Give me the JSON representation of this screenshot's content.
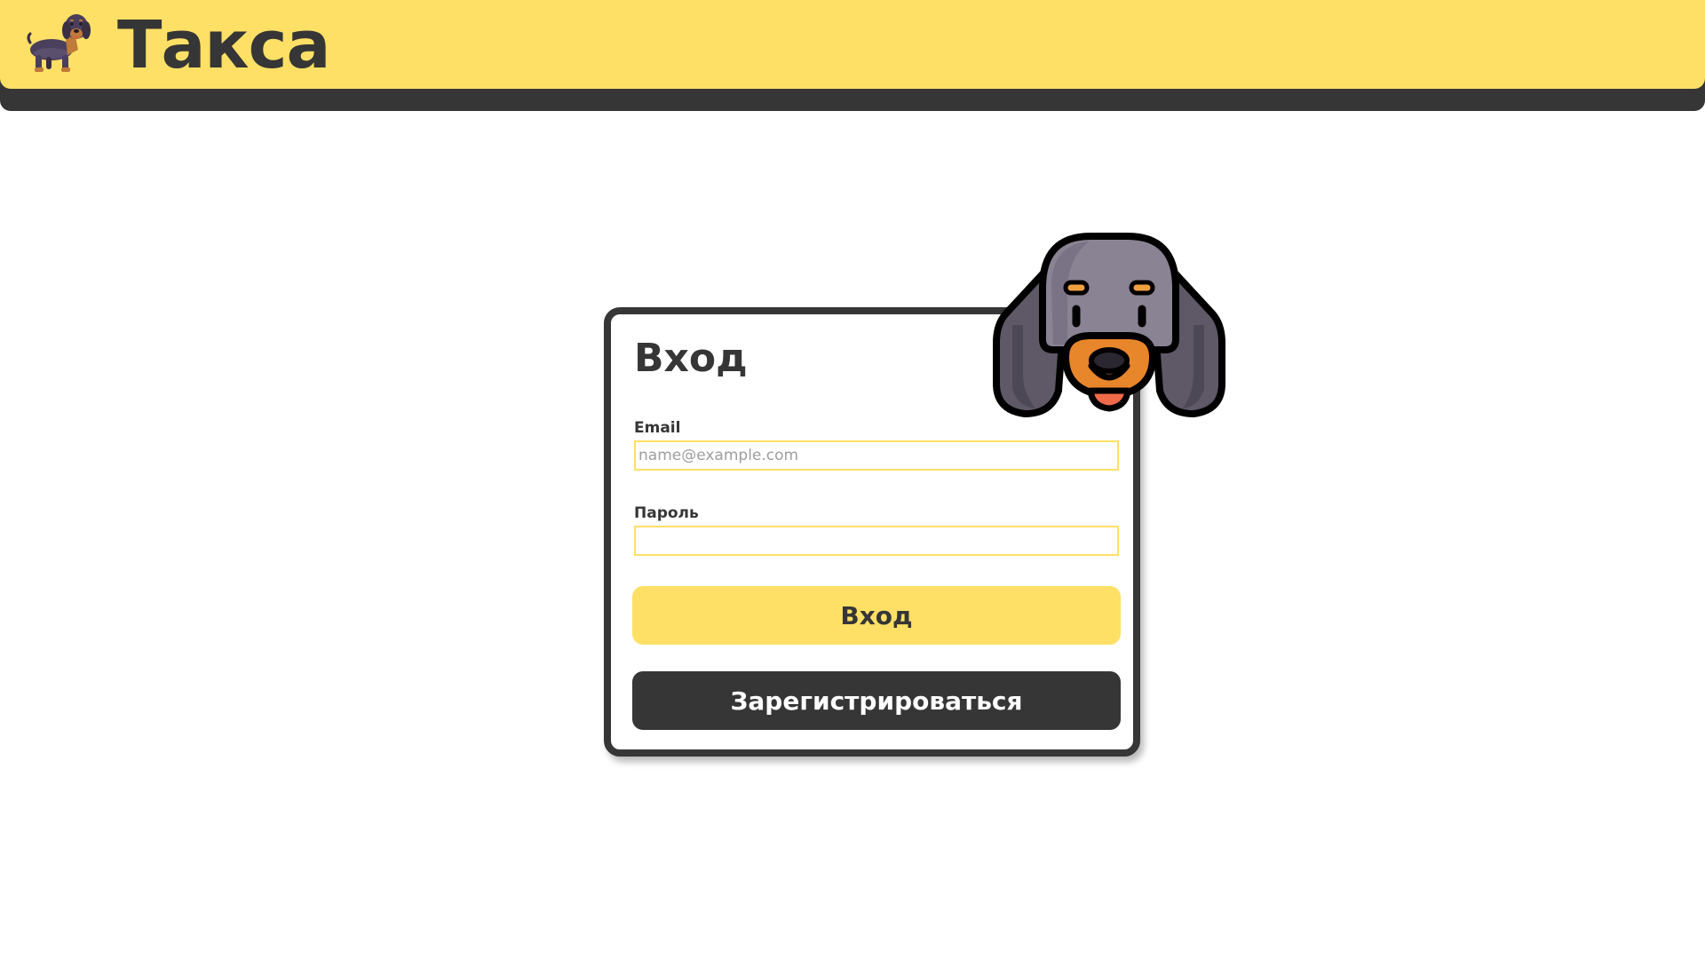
{
  "header": {
    "brand": "Такса",
    "logo_icon": "dachshund-icon",
    "background": "#ffe066",
    "shadow_bar": "#363636"
  },
  "login": {
    "title": "Вход",
    "email_label": "Email",
    "email_placeholder": "name@example.com",
    "email_value": "",
    "password_label": "Пароль",
    "password_value": "",
    "login_button": "Вход",
    "register_button": "Зарегистрироваться",
    "mascot_icon": "dog-face-icon"
  },
  "colors": {
    "accent": "#ffe066",
    "dark": "#363636"
  }
}
